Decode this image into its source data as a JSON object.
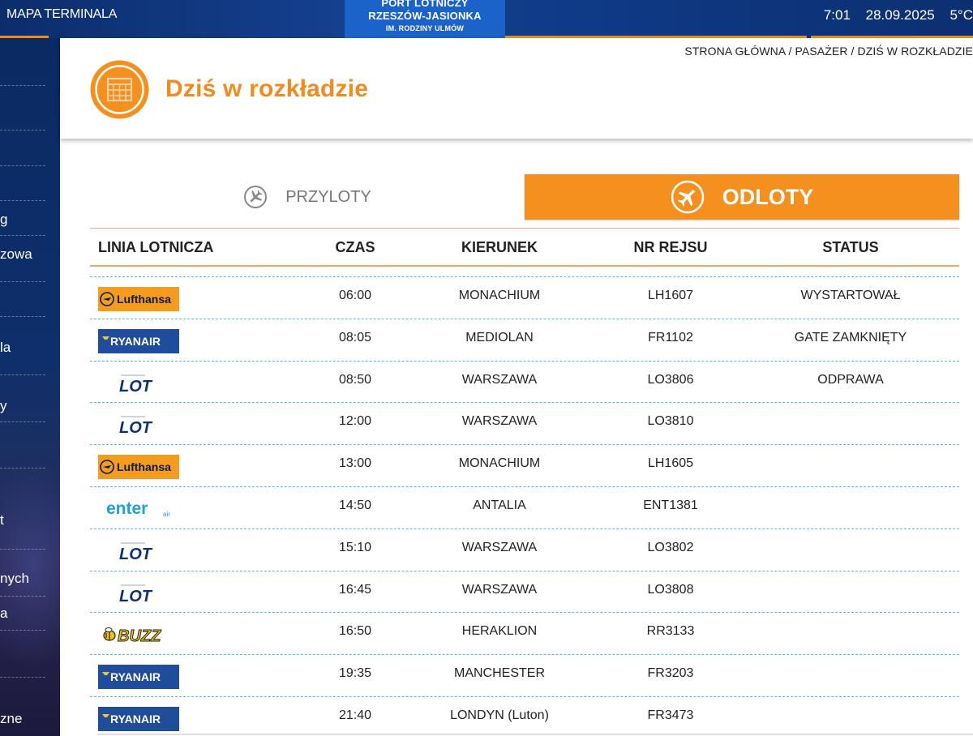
{
  "topbar": {
    "map_link": "MAPA TERMINALA",
    "time": "7:01",
    "date": "28.09.2025",
    "temperature": "5°C"
  },
  "logo": {
    "line1": "PORT LOTNICZY",
    "line2": "RZESZÓW-JASIONKA",
    "line3": "IM. RODZINY ULMÓW"
  },
  "sidebar": {
    "fragments": [
      "g",
      "zowa",
      "la",
      "y",
      "t",
      "nych",
      "a",
      "zne"
    ]
  },
  "header": {
    "breadcrumb": "STRONA GŁÓWNA / PASAŻER / DZIŚ W ROZKŁADZIE",
    "title": "Dziś w rozkładzie"
  },
  "tabs": {
    "arrivals": "PRZYLOTY",
    "departures": "ODLOTY"
  },
  "table": {
    "headers": {
      "airline": "LINIA LOTNICZA",
      "time": "CZAS",
      "destination": "KIERUNEK",
      "flight": "NR REJSU",
      "status": "STATUS"
    },
    "rows": [
      {
        "airline": "Lufthansa",
        "time": "06:00",
        "destination": "MONACHIUM",
        "flight": "LH1607",
        "status": "WYSTARTOWAŁ"
      },
      {
        "airline": "RYANAIR",
        "time": "08:05",
        "destination": "MEDIOLAN",
        "flight": "FR1102",
        "status": "GATE ZAMKNIĘTY"
      },
      {
        "airline": "LOT",
        "time": "08:50",
        "destination": "WARSZAWA",
        "flight": "LO3806",
        "status": "ODPRAWA"
      },
      {
        "airline": "LOT",
        "time": "12:00",
        "destination": "WARSZAWA",
        "flight": "LO3810",
        "status": ""
      },
      {
        "airline": "Lufthansa",
        "time": "13:00",
        "destination": "MONACHIUM",
        "flight": "LH1605",
        "status": ""
      },
      {
        "airline": "enter",
        "time": "14:50",
        "destination": "ANTALIA",
        "flight": "ENT1381",
        "status": ""
      },
      {
        "airline": "LOT",
        "time": "15:10",
        "destination": "WARSZAWA",
        "flight": "LO3802",
        "status": ""
      },
      {
        "airline": "LOT",
        "time": "16:45",
        "destination": "WARSZAWA",
        "flight": "LO3808",
        "status": ""
      },
      {
        "airline": "BUZZ",
        "time": "16:50",
        "destination": "HERAKLION",
        "flight": "RR3133",
        "status": ""
      },
      {
        "airline": "RYANAIR",
        "time": "19:35",
        "destination": "MANCHESTER",
        "flight": "FR3203",
        "status": ""
      },
      {
        "airline": "RYANAIR",
        "time": "21:40",
        "destination": "LONDYN (Luton)",
        "flight": "FR3473",
        "status": ""
      }
    ]
  },
  "colors": {
    "brand_navy": "#0c2d6b",
    "accent_orange": "#f5901e",
    "row_separator": "#58b6e2"
  }
}
